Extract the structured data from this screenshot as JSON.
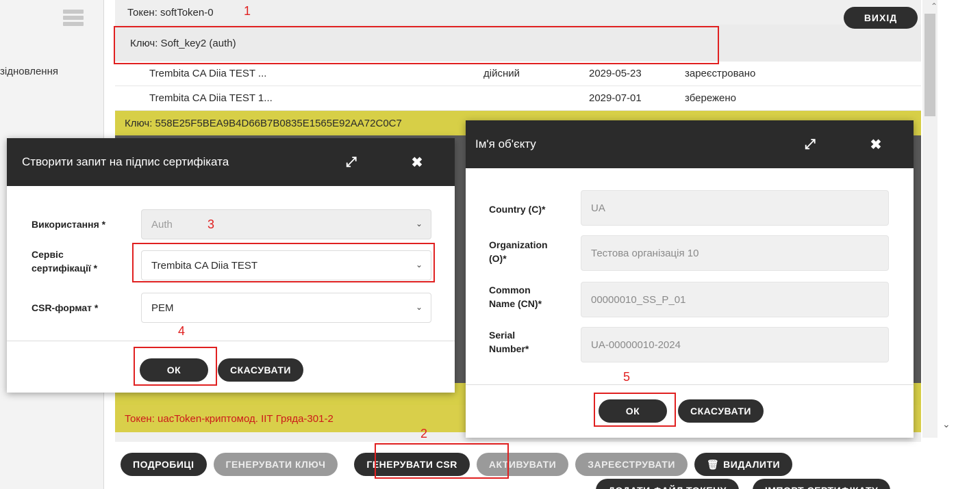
{
  "sidebar": {
    "label": "зідновлення"
  },
  "header": {
    "exit_label": "ВИХІД"
  },
  "table": {
    "token_top": "Токен: softToken-0",
    "key1": "Ключ: Soft_key2 (auth)",
    "certs": [
      {
        "name": "Trembita CA Diia TEST ...",
        "state": "дійсний",
        "date": "2029-05-23",
        "status": "зареєстровано"
      },
      {
        "name": "Trembita CA Diia TEST 1...",
        "state": "",
        "date": "2029-07-01",
        "status": "збережено"
      }
    ],
    "key2": "Ключ: 558E25F5BEA9B4D66B7B0835E1565E92AA72C0C7",
    "token_bottom": "Токен: uacToken-криптомод. ІІТ Гряда-301-2"
  },
  "toolbar": {
    "buttons": [
      "ПОДРОБИЦІ",
      "ГЕНЕРУВАТИ КЛЮЧ",
      "ГЕНЕРУВАТИ CSR",
      "АКТИВУВАТИ",
      "ЗАРЕЄСТРУВАТИ",
      "ВИДАЛИТИ"
    ],
    "second_row": [
      "ДОДАТИ ФАЙЛ ТОКЕНУ",
      "ІМПОРТ СЕРТИФІКАТУ"
    ]
  },
  "csr_dialog": {
    "title": "Створити запит на підпис сертифіката",
    "usage_label": "Використання *",
    "usage_value": "Auth",
    "ca_label_1": "Сервіс",
    "ca_label_2": "сертифікації *",
    "ca_value": "Trembita CA Diia TEST",
    "format_label": "CSR-формат *",
    "format_value": "PEM",
    "ok_label": "ОК",
    "cancel_label": "СКАСУВАТИ"
  },
  "subject_dialog": {
    "title": "Ім'я об'єкту",
    "country_label": "Country (C)*",
    "country_value": "UA",
    "org_label_1": "Organization",
    "org_label_2": "(O)*",
    "org_value": "Тестова організація 10",
    "cn_label_1": "Common",
    "cn_label_2": "Name (CN)*",
    "cn_value": "00000010_SS_P_01",
    "serial_label_1": "Serial",
    "serial_label_2": "Number*",
    "serial_value": "UA-00000010-2024",
    "ok_label": "ОК",
    "cancel_label": "СКАСУВАТИ"
  },
  "annotations": [
    "1",
    "2",
    "3",
    "4",
    "5"
  ],
  "colors": {
    "accent_yellow": "#d7cf47",
    "annotation_red": "#e02020",
    "dark": "#2b2b2b"
  }
}
